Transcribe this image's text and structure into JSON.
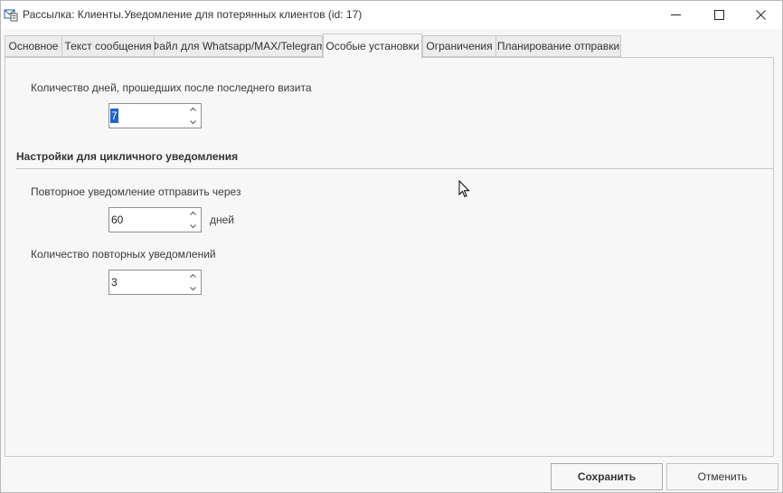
{
  "window": {
    "title": "Рассылка: Клиенты.Уведомление для потерянных клиентов (id: 17)"
  },
  "tabs": [
    {
      "label": "Основное",
      "active": false
    },
    {
      "label": "Текст сообщения",
      "active": false
    },
    {
      "label": "Файл для Whatsapp/MAX/Telegram",
      "active": false
    },
    {
      "label": "Особые установки",
      "active": true
    },
    {
      "label": "Ограничения",
      "active": false
    },
    {
      "label": "Планирование отправки",
      "active": false
    }
  ],
  "form": {
    "days_since_visit": {
      "label": "Количество дней, прошедших после последнего визита",
      "value": "7"
    },
    "cyclic_section_title": "Настройки для цикличного уведомления",
    "repeat_after": {
      "label": "Повторное уведомление отправить через",
      "value": "60",
      "unit": "дней"
    },
    "repeat_count": {
      "label": "Количество повторных уведомлений",
      "value": "3"
    }
  },
  "buttons": {
    "save": "Сохранить",
    "cancel": "Отменить"
  },
  "icons": {
    "app": "mail-document-icon",
    "minimize": "minimize-icon",
    "maximize": "maximize-icon",
    "close": "close-icon"
  },
  "colors": {
    "selection": "#1e64c8",
    "window_bg": "#f7f7f7"
  }
}
